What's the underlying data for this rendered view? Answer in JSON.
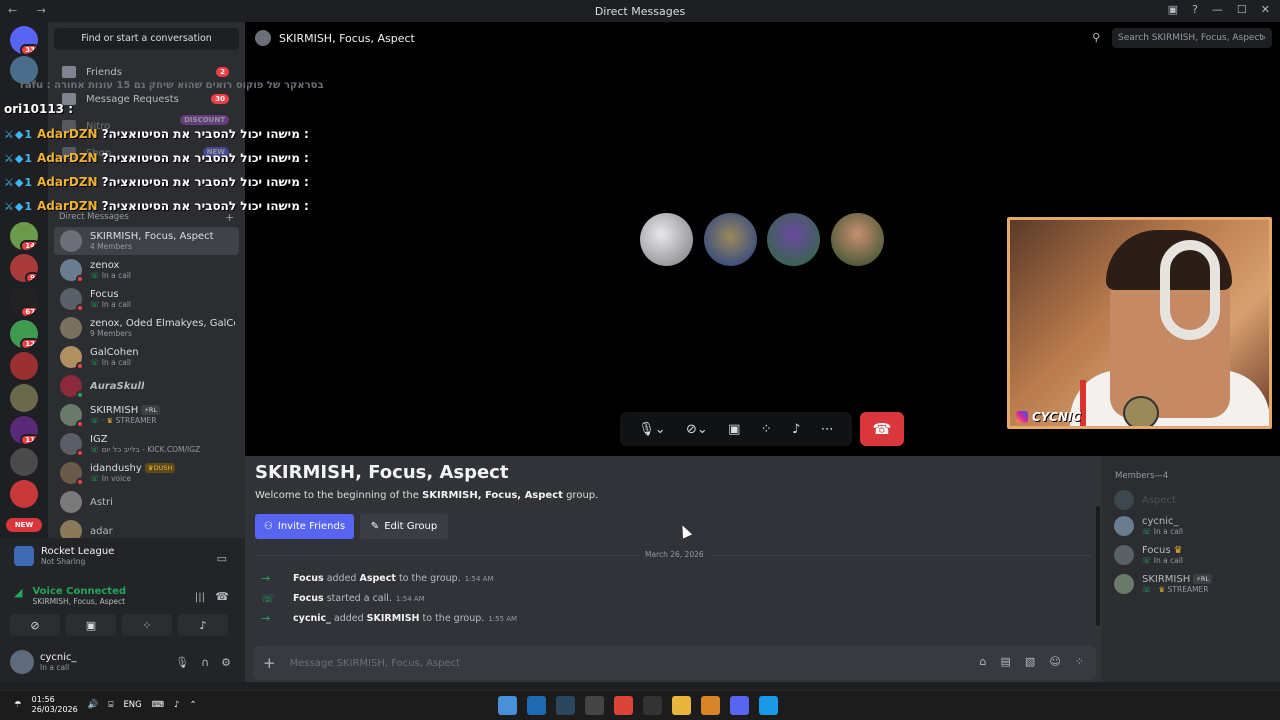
{
  "window": {
    "title": "Direct Messages",
    "nav_label": "←  →"
  },
  "servers": {
    "home_badge": "33",
    "badges": [
      "14",
      "9",
      "67",
      "12",
      "11"
    ],
    "new_pill": "NEW"
  },
  "sidebar": {
    "find_placeholder": "Find or start a conversation",
    "nav": [
      {
        "label": "Friends",
        "count": "2"
      },
      {
        "label": "Message Requests",
        "count": "30"
      },
      {
        "label": "Nitro",
        "count": "DISCOUNT"
      },
      {
        "label": "Shop",
        "count": "NEW"
      }
    ],
    "dm_header": "Direct Messages",
    "dms": [
      {
        "name": "SKIRMISH, Focus, Aspect",
        "sub": "4 Members"
      },
      {
        "name": "zenox",
        "sub": "In a call"
      },
      {
        "name": "Focus",
        "sub": "In a call"
      },
      {
        "name": "zenox, Oded Elmakyes, GalCo...",
        "sub": "9 Members"
      },
      {
        "name": "GalCohen",
        "sub": "In a call"
      },
      {
        "name": "AuraSkull",
        "sub": ""
      },
      {
        "name": "SKIRMISH",
        "tag": "RL",
        "sub": "STREAMER"
      },
      {
        "name": "IGZ",
        "sub": "בלייב כל יום - KICK.COM/IGZ"
      },
      {
        "name": "idandushy",
        "tag": "DUSH",
        "sub": "In voice"
      },
      {
        "name": "Astri",
        "sub": ""
      },
      {
        "name": "adar",
        "sub": ""
      }
    ]
  },
  "activity": {
    "game": "Rocket League",
    "game_sub": "Not Sharing",
    "voice_status": "Voice Connected",
    "voice_channel": "SKIRMISH, Focus, Aspect"
  },
  "user": {
    "name": "cycnic_",
    "status": "In a call"
  },
  "channel": {
    "title": "SKIRMISH, Focus, Aspect",
    "search_placeholder": "Search SKIRMISH, Focus, Aspect"
  },
  "overlay": {
    "faint_line": "rafu : בסראקר של פוקוס רואים שהוא שיחק גם 15 עונות אחורה",
    "user_line": "ori10113 :",
    "lines": [
      {
        "name": "AdarDZN",
        "msg": ": מישהו יכול להסביר את הסיטואציה?"
      },
      {
        "name": "AdarDZN",
        "msg": ": מישהו יכול להסביר את הסיטואציה?"
      },
      {
        "name": "AdarDZN",
        "msg": ": מישהו יכול להסביר את הסיטואציה?"
      },
      {
        "name": "AdarDZN",
        "msg": ": מישהו יכול להסביר את הסיטואציה?"
      }
    ],
    "badges": "⚔◆1"
  },
  "webcam": {
    "label": "CYCNIC"
  },
  "chat": {
    "heading": "SKIRMISH, Focus, Aspect",
    "welcome_pre": "Welcome to the beginning of the ",
    "welcome_bold": "SKIRMISH, Focus, Aspect",
    "welcome_post": " group.",
    "invite_label": "Invite Friends",
    "edit_label": "Edit Group",
    "date": "March 26, 2026",
    "messages": [
      {
        "actor": "Focus",
        "mid": " added ",
        "target": "Aspect",
        "tail": " to the group.",
        "time": "1:54 AM"
      },
      {
        "actor": "Focus",
        "mid": " started a call.",
        "target": "",
        "tail": "",
        "time": "1:54 AM"
      },
      {
        "actor": "cycnic_",
        "mid": " added ",
        "target": "SKIRMISH",
        "tail": " to the group.",
        "time": "1:55 AM"
      }
    ],
    "composer_placeholder": "Message SKIRMISH, Focus, Aspect"
  },
  "members": {
    "header": "Members—4",
    "list": [
      {
        "name": "Aspect",
        "sub": ""
      },
      {
        "name": "cycnic_",
        "sub": "In a call"
      },
      {
        "name": "Focus",
        "sub": "In a call"
      },
      {
        "name": "SKIRMISH",
        "tag": "RL",
        "sub": "STREAMER"
      }
    ]
  },
  "taskbar": {
    "time": "01:56",
    "date": "26/03/2026",
    "lang": "ENG"
  },
  "colors": {
    "accent": "#5865f2",
    "online": "#23a55a",
    "danger": "#da373c"
  }
}
